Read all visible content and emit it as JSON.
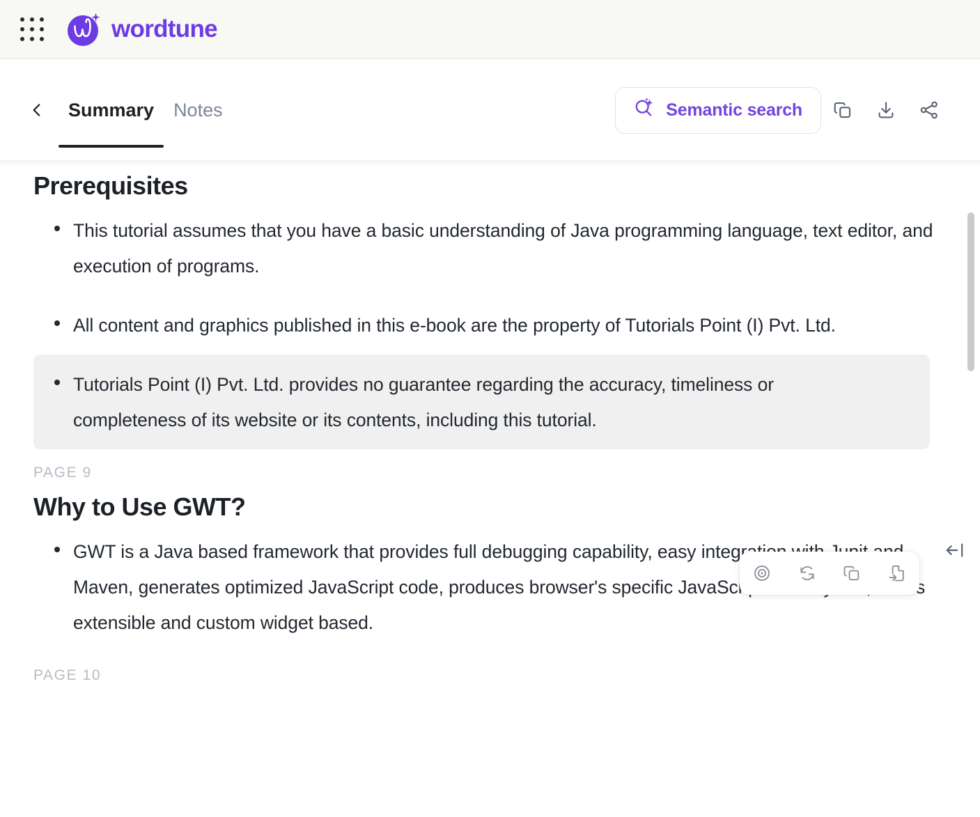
{
  "app": {
    "brand_name": "wordtune",
    "apps_grid_icon": "apps-grid-icon",
    "brand_logo_icon": "wordtune-logo-icon",
    "brand_color": "#6D3BE4"
  },
  "toolbar": {
    "back_icon": "chevron-left-icon",
    "tabs": [
      {
        "label": "Summary",
        "active": true
      },
      {
        "label": "Notes",
        "active": false
      }
    ],
    "semantic_search": {
      "label": "Semantic search",
      "icon": "magic-search-icon",
      "color": "#7444E0"
    },
    "actions": [
      {
        "name": "copy-button",
        "icon": "copy-icon"
      },
      {
        "name": "download-button",
        "icon": "download-icon"
      },
      {
        "name": "share-button",
        "icon": "share-icon"
      }
    ]
  },
  "document": {
    "sections": [
      {
        "title": "Prerequisites",
        "bullets": [
          {
            "text": "This tutorial assumes that you have a basic understanding of Java programming language, text editor, and execution of programs.",
            "highlighted": false
          },
          {
            "text": "All content and graphics published in this e-book are the property of Tutorials Point (I) Pvt. Ltd.",
            "highlighted": false
          },
          {
            "text": "Tutorials Point (I) Pvt. Ltd. provides no guarantee regarding the accuracy, timeliness or completeness of its website or its contents, including this tutorial.",
            "highlighted": true
          }
        ],
        "page_label": "PAGE 9"
      },
      {
        "title": "Why to Use GWT?",
        "bullets": [
          {
            "text": "GWT is a Java based framework that provides full debugging capability, easy integration with Junit and Maven, generates optimized JavaScript code, produces browser's specific JavaScript code by self, and is extensible and custom widget based.",
            "highlighted": false
          }
        ],
        "page_label": "PAGE 10"
      }
    ]
  },
  "float_toolbar": {
    "actions": [
      {
        "name": "focus-source-button",
        "icon": "target-icon"
      },
      {
        "name": "regenerate-button",
        "icon": "refresh-icon"
      },
      {
        "name": "copy-snippet-button",
        "icon": "copy-icon"
      },
      {
        "name": "add-to-document-button",
        "icon": "file-export-icon"
      }
    ]
  },
  "panel": {
    "collapse_icon": "collapse-panel-left-icon"
  },
  "scrollbar": {
    "thumb_color": "#C8CACC"
  }
}
